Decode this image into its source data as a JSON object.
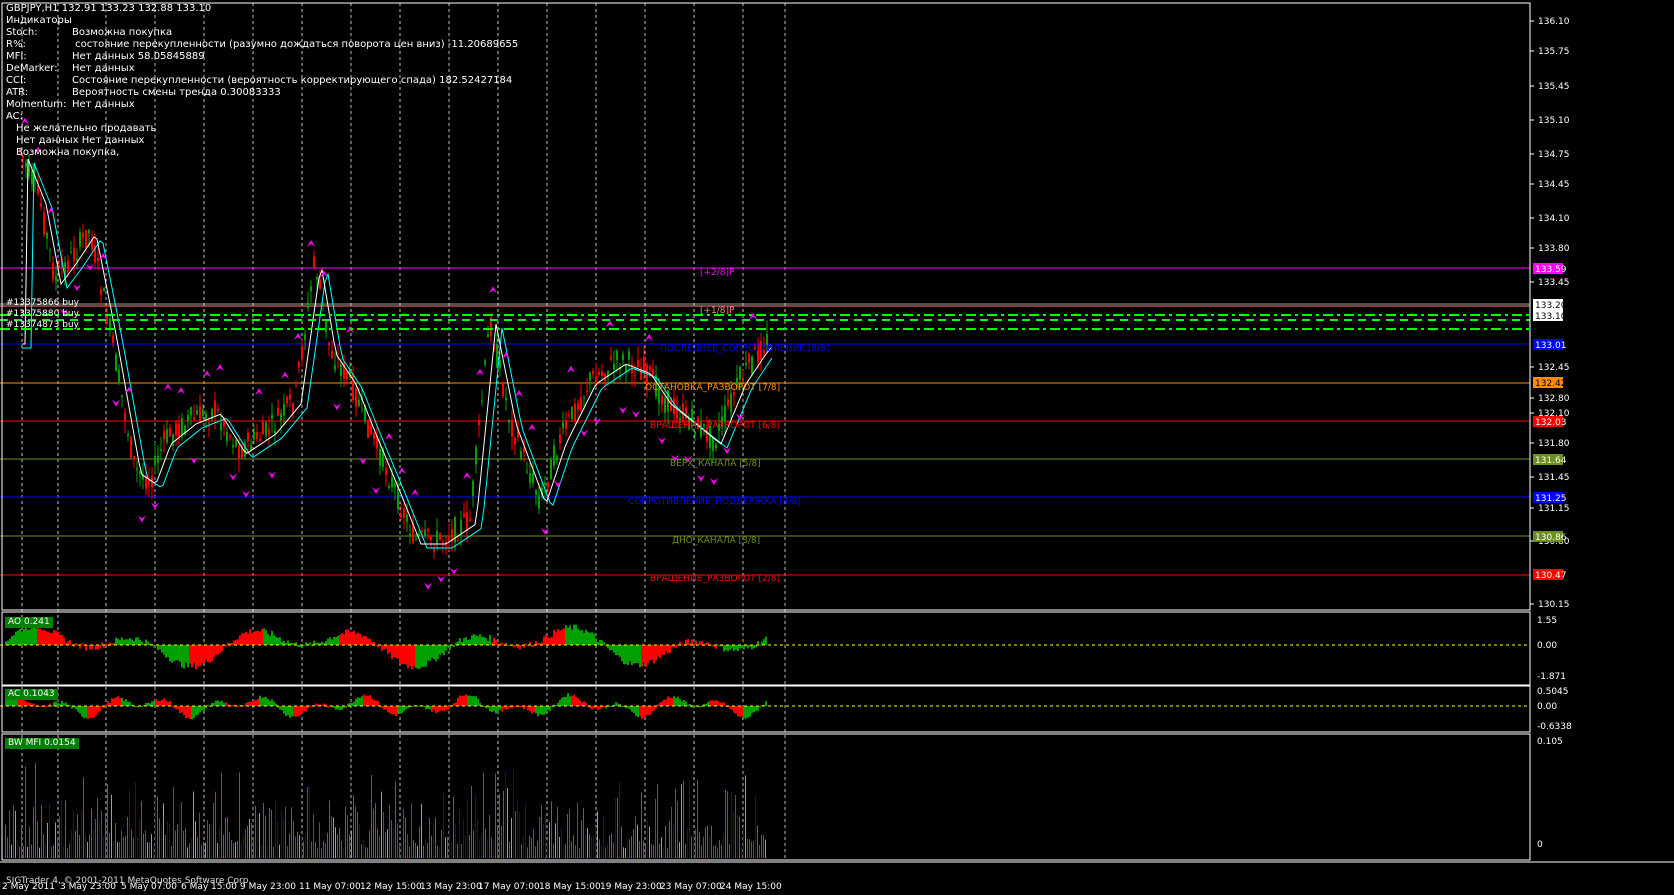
{
  "header": {
    "symbol_line": "GBPJPY,H1  132.91 133.23 132.88 133.10",
    "indicators_title": "Индикаторы"
  },
  "indicators": [
    {
      "name": "Stoch:",
      "text": "Возможна покупка"
    },
    {
      "name": "R%:",
      "text": " состояние перекупленности (разумно дождаться поворота цен вниз) -11.20689655"
    },
    {
      "name": "MFI:",
      "text": "Нет данных 58.05845889"
    },
    {
      "name": "DeMarker:",
      "text": "Нет данных"
    },
    {
      "name": "CCI:",
      "text": "Состояние перекупленности (вероятность корректирующего спада) 182.52427184"
    },
    {
      "name": "ATR:",
      "text": "Вероятность смены тренда 0.30083333"
    },
    {
      "name": "Momentum:",
      "text": "Нет данных"
    },
    {
      "name": "AC:",
      "text": ""
    }
  ],
  "indicator_notes": [
    "Не желательно продавать",
    "Нет данных Нет данных",
    "Возможна покупка,"
  ],
  "orders": [
    "#13375866 buy",
    "#13375880 buy",
    "#13374873 buy"
  ],
  "price_axis": {
    "ticks": [
      "136.10",
      "135.75",
      "135.45",
      "135.10",
      "134.75",
      "134.45",
      "134.10",
      "133.80",
      "133.45",
      "132.80",
      "132.45",
      "132.10",
      "131.80",
      "131.45",
      "131.15",
      "130.80",
      "130.15"
    ],
    "boxes": [
      {
        "label": "133.59",
        "bg": "#ff00ff",
        "fg": "#ffffff"
      },
      {
        "label": "133.20",
        "bg": "#ffffff",
        "fg": "#000000"
      },
      {
        "label": "133.10",
        "bg": "#ffffff",
        "fg": "#000000"
      },
      {
        "label": "133.01",
        "bg": "#0000ff",
        "fg": "#ffffff"
      },
      {
        "label": "132.42",
        "bg": "#ff8c00",
        "fg": "#000000"
      },
      {
        "label": "132.03",
        "bg": "#ff0000",
        "fg": "#ffffff"
      },
      {
        "label": "131.64",
        "bg": "#6b8e23",
        "fg": "#ffffff"
      },
      {
        "label": "131.25",
        "bg": "#0000ff",
        "fg": "#ffffff"
      },
      {
        "label": "130.86",
        "bg": "#6b8e23",
        "fg": "#ffffff"
      },
      {
        "label": "130.47",
        "bg": "#ff0000",
        "fg": "#ffffff"
      }
    ]
  },
  "murrey_levels": [
    {
      "label": "[+2/8]P",
      "color": "#ff00ff"
    },
    {
      "label": "[+1/8]P",
      "color": "#ff8080"
    },
    {
      "label": "ПОСЛЕДНЕЕ_СОПРОТИВЛЕНИЕ [8/8]",
      "color": "#0000ff"
    },
    {
      "label": "ОСТАНОВКА_РАЗВОРОТ [7/8]",
      "color": "#ff8c00"
    },
    {
      "label": "ВРАЩЕНИЕ_РАЗВОРОТ [6/8]",
      "color": "#ff0000"
    },
    {
      "label": "ВЕРХ_КАНАЛА [5/8]",
      "color": "#6b8e23"
    },
    {
      "label": "СОПРОТИВЛЕНИЕ_ПОДДЕРЖКА [4/8]",
      "color": "#0000ff"
    },
    {
      "label": "ДНО_КАНАЛА [3/8]",
      "color": "#6b8e23"
    },
    {
      "label": "ВРАЩЕНИЕ_РАЗВОРОТ [2/8]",
      "color": "#ff0000"
    }
  ],
  "subwindows": {
    "ao": {
      "label": "AO 0.241",
      "ticks": [
        "1.55",
        "0.00",
        "-1.871"
      ]
    },
    "ac": {
      "label": "AC 0.1043",
      "ticks": [
        "0.5045",
        "0.00",
        "-0.6338"
      ]
    },
    "mfi": {
      "label": "BW MFI 0.0154",
      "ticks": [
        "0.105",
        "0"
      ]
    }
  },
  "time_axis": [
    "2 May 2011",
    "3 May 23:00",
    "5 May 07:00",
    "6 May 15:00",
    "9 May 23:00",
    "11 May 07:00",
    "12 May 15:00",
    "13 May 23:00",
    "17 May 07:00",
    "18 May 15:00",
    "19 May 23:00",
    "23 May 07:00",
    "24 May 15:00"
  ],
  "copyright": "SIGTrader 4, © 2001-2011 MetaQuotes Software Corp.",
  "colors": {
    "bull": "#00a000",
    "bear": "#ff0000",
    "grid": "#ffffff",
    "ma_fast": "#ffffff",
    "ma_slow": "#00ffff",
    "fractal": "#ff00ff"
  }
}
